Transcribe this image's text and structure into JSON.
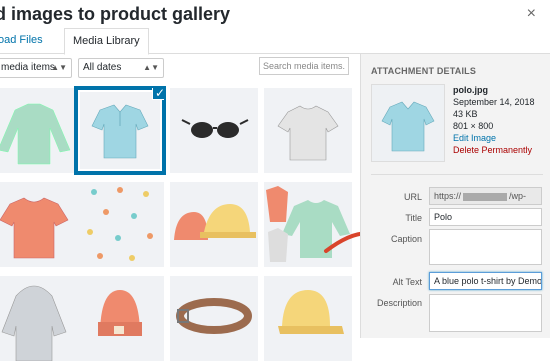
{
  "header": {
    "title": "ld images to product gallery",
    "close_glyph": "×"
  },
  "tabs": [
    {
      "label": "oad Files"
    },
    {
      "label": "Media Library"
    }
  ],
  "toolbar": {
    "filter_type": "media items",
    "filter_date": "All dates",
    "search_placeholder": "Search media items."
  },
  "grid": {
    "items": [
      {
        "name": "green-long-sleeve-shirt",
        "selected": false
      },
      {
        "name": "blue-polo",
        "selected": true
      },
      {
        "name": "sunglasses",
        "selected": false
      },
      {
        "name": "grey-tshirt",
        "selected": false
      },
      {
        "name": "red-tshirt",
        "selected": false
      },
      {
        "name": "pattern-items",
        "selected": false
      },
      {
        "name": "caps",
        "selected": false
      },
      {
        "name": "shirts-collage",
        "selected": false
      },
      {
        "name": "grey-hoodie",
        "selected": false
      },
      {
        "name": "red-beanie",
        "selected": false
      },
      {
        "name": "belt",
        "selected": false
      },
      {
        "name": "yellow-cap",
        "selected": false
      }
    ],
    "check_glyph": "✓"
  },
  "attachment": {
    "heading": "ATTACHMENT DETAILS",
    "filename": "polo.jpg",
    "date": "September 14, 2018",
    "size": "43 KB",
    "dimensions": "801 × 800",
    "edit_label": "Edit Image",
    "delete_label": "Delete Permanently",
    "url_label": "URL",
    "url_prefix": "https://",
    "url_suffix": "/wp-",
    "title_label": "Title",
    "title_value": "Polo",
    "caption_label": "Caption",
    "alt_label": "Alt Text",
    "alt_value": "A blue polo t-shirt by Demo",
    "description_label": "Description"
  },
  "colors": {
    "accent": "#0073aa",
    "danger": "#a00000",
    "arrow": "#d9442b"
  }
}
